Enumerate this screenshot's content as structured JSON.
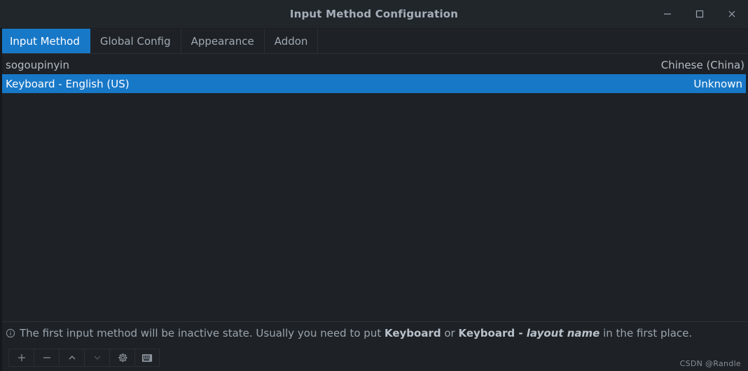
{
  "window": {
    "title": "Input Method Configuration",
    "controls": {
      "minimize": "minimize",
      "maximize": "maximize",
      "close": "close"
    }
  },
  "tabs": [
    {
      "label": "Input Method",
      "active": true
    },
    {
      "label": "Global Config",
      "active": false
    },
    {
      "label": "Appearance",
      "active": false
    },
    {
      "label": "Addon",
      "active": false
    }
  ],
  "input_methods": [
    {
      "name": "sogoupinyin",
      "language": "Chinese (China)",
      "selected": false
    },
    {
      "name": "Keyboard - English (US)",
      "language": "Unknown",
      "selected": true
    }
  ],
  "info": {
    "icon": "info-circle-icon",
    "part1": "The first input method will be inactive state. Usually you need to put ",
    "bold1": "Keyboard",
    "part2": " or ",
    "bold2": "Keyboard - ",
    "italic1": "layout name",
    "part3": " in the first place."
  },
  "toolbar": {
    "buttons": [
      {
        "name": "add-input-method-button",
        "icon": "plus-icon",
        "disabled": false
      },
      {
        "name": "remove-input-method-button",
        "icon": "minus-icon",
        "disabled": false
      },
      {
        "name": "move-up-button",
        "icon": "chevron-up-icon",
        "disabled": false
      },
      {
        "name": "move-down-button",
        "icon": "chevron-down-icon",
        "disabled": true
      },
      {
        "name": "configure-button",
        "icon": "gear-icon",
        "disabled": false
      },
      {
        "name": "keyboard-layout-button",
        "icon": "keyboard-icon",
        "disabled": false
      }
    ]
  },
  "watermark": "CSDN @Randle",
  "colors": {
    "accent": "#1878c8",
    "background": "#1e2226",
    "titlebar": "#21262b",
    "text": "#b4bcc5",
    "muted": "#9aa4ae"
  }
}
